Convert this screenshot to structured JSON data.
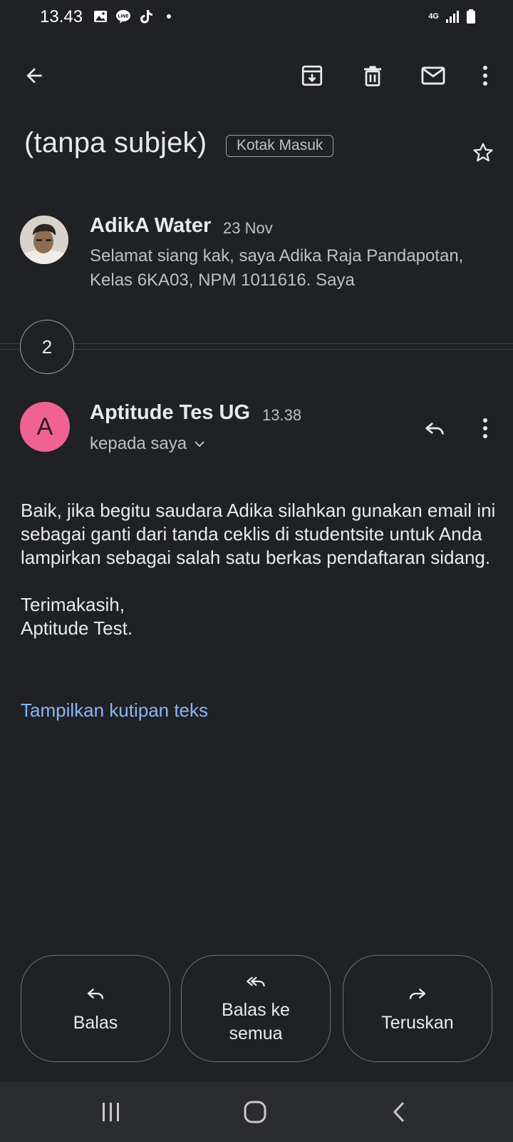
{
  "status_bar": {
    "time": "13.43",
    "network": "4G",
    "icons": [
      "gallery-icon",
      "line-icon",
      "tiktok-icon",
      "dot-icon",
      "signal-icon",
      "battery-icon"
    ]
  },
  "toolbar": {
    "icons": [
      "back-arrow-icon",
      "archive-icon",
      "delete-icon",
      "mark-unread-icon",
      "more-vert-icon"
    ]
  },
  "thread": {
    "subject": "(tanpa subjek)",
    "label": "Kotak Masuk",
    "starred": false
  },
  "messages": {
    "first": {
      "sender": "AdikA Water",
      "date": "23 Nov",
      "snippet": "Selamat siang kak, saya Adika Raja Pandapotan, Kelas 6KA03, NPM 1011616. Saya"
    },
    "collapsed_count": "2",
    "current": {
      "avatar_letter": "A",
      "avatar_color": "#f06292",
      "sender": "Aptitude Tes UG",
      "time": "13.38",
      "recipient": "kepada saya",
      "body_paragraph_1": "Baik, jika begitu saudara Adika silahkan gunakan email ini sebagai ganti dari tanda ceklis di studentsite untuk Anda lampirkan sebagai salah satu berkas pendaftaran sidang.",
      "body_closing_1": "Terimakasih,",
      "body_closing_2": "Aptitude Test.",
      "show_quoted": "Tampilkan kutipan teks",
      "link_color": "#8ab4f8"
    }
  },
  "actions": {
    "reply": "Balas",
    "reply_all_line1": "Balas ke",
    "reply_all_line2": "semua",
    "forward": "Teruskan"
  },
  "navigation": {
    "icons": [
      "recents-icon",
      "home-icon",
      "nav-back-icon"
    ]
  }
}
